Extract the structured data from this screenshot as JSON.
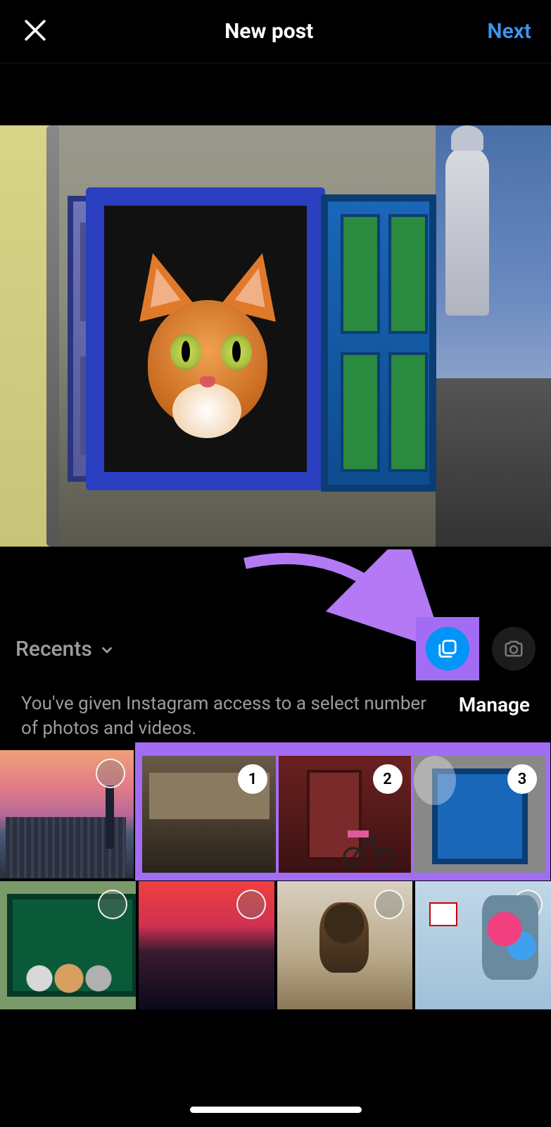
{
  "header": {
    "title": "New post",
    "next_label": "Next"
  },
  "colors": {
    "link_blue": "#3897f0",
    "select_blue": "#0095f6",
    "annotation_purple": "#a36cf5"
  },
  "album": {
    "selector_label": "Recents"
  },
  "access": {
    "message": "You've given Instagram access to a select number of photos and videos.",
    "manage_label": "Manage"
  },
  "grid": {
    "row1": [
      {
        "selected": false,
        "number": null
      },
      {
        "selected": true,
        "number": "1"
      },
      {
        "selected": true,
        "number": "2"
      },
      {
        "selected": true,
        "number": "3"
      }
    ],
    "row2": [
      {
        "selected": false,
        "number": null
      },
      {
        "selected": false,
        "number": null
      },
      {
        "selected": false,
        "number": null
      },
      {
        "selected": false,
        "number": null
      }
    ]
  },
  "icons": {
    "close": "close-icon",
    "chevron_down": "chevron-down-icon",
    "multiselect": "multiselect-icon",
    "camera": "camera-icon"
  }
}
